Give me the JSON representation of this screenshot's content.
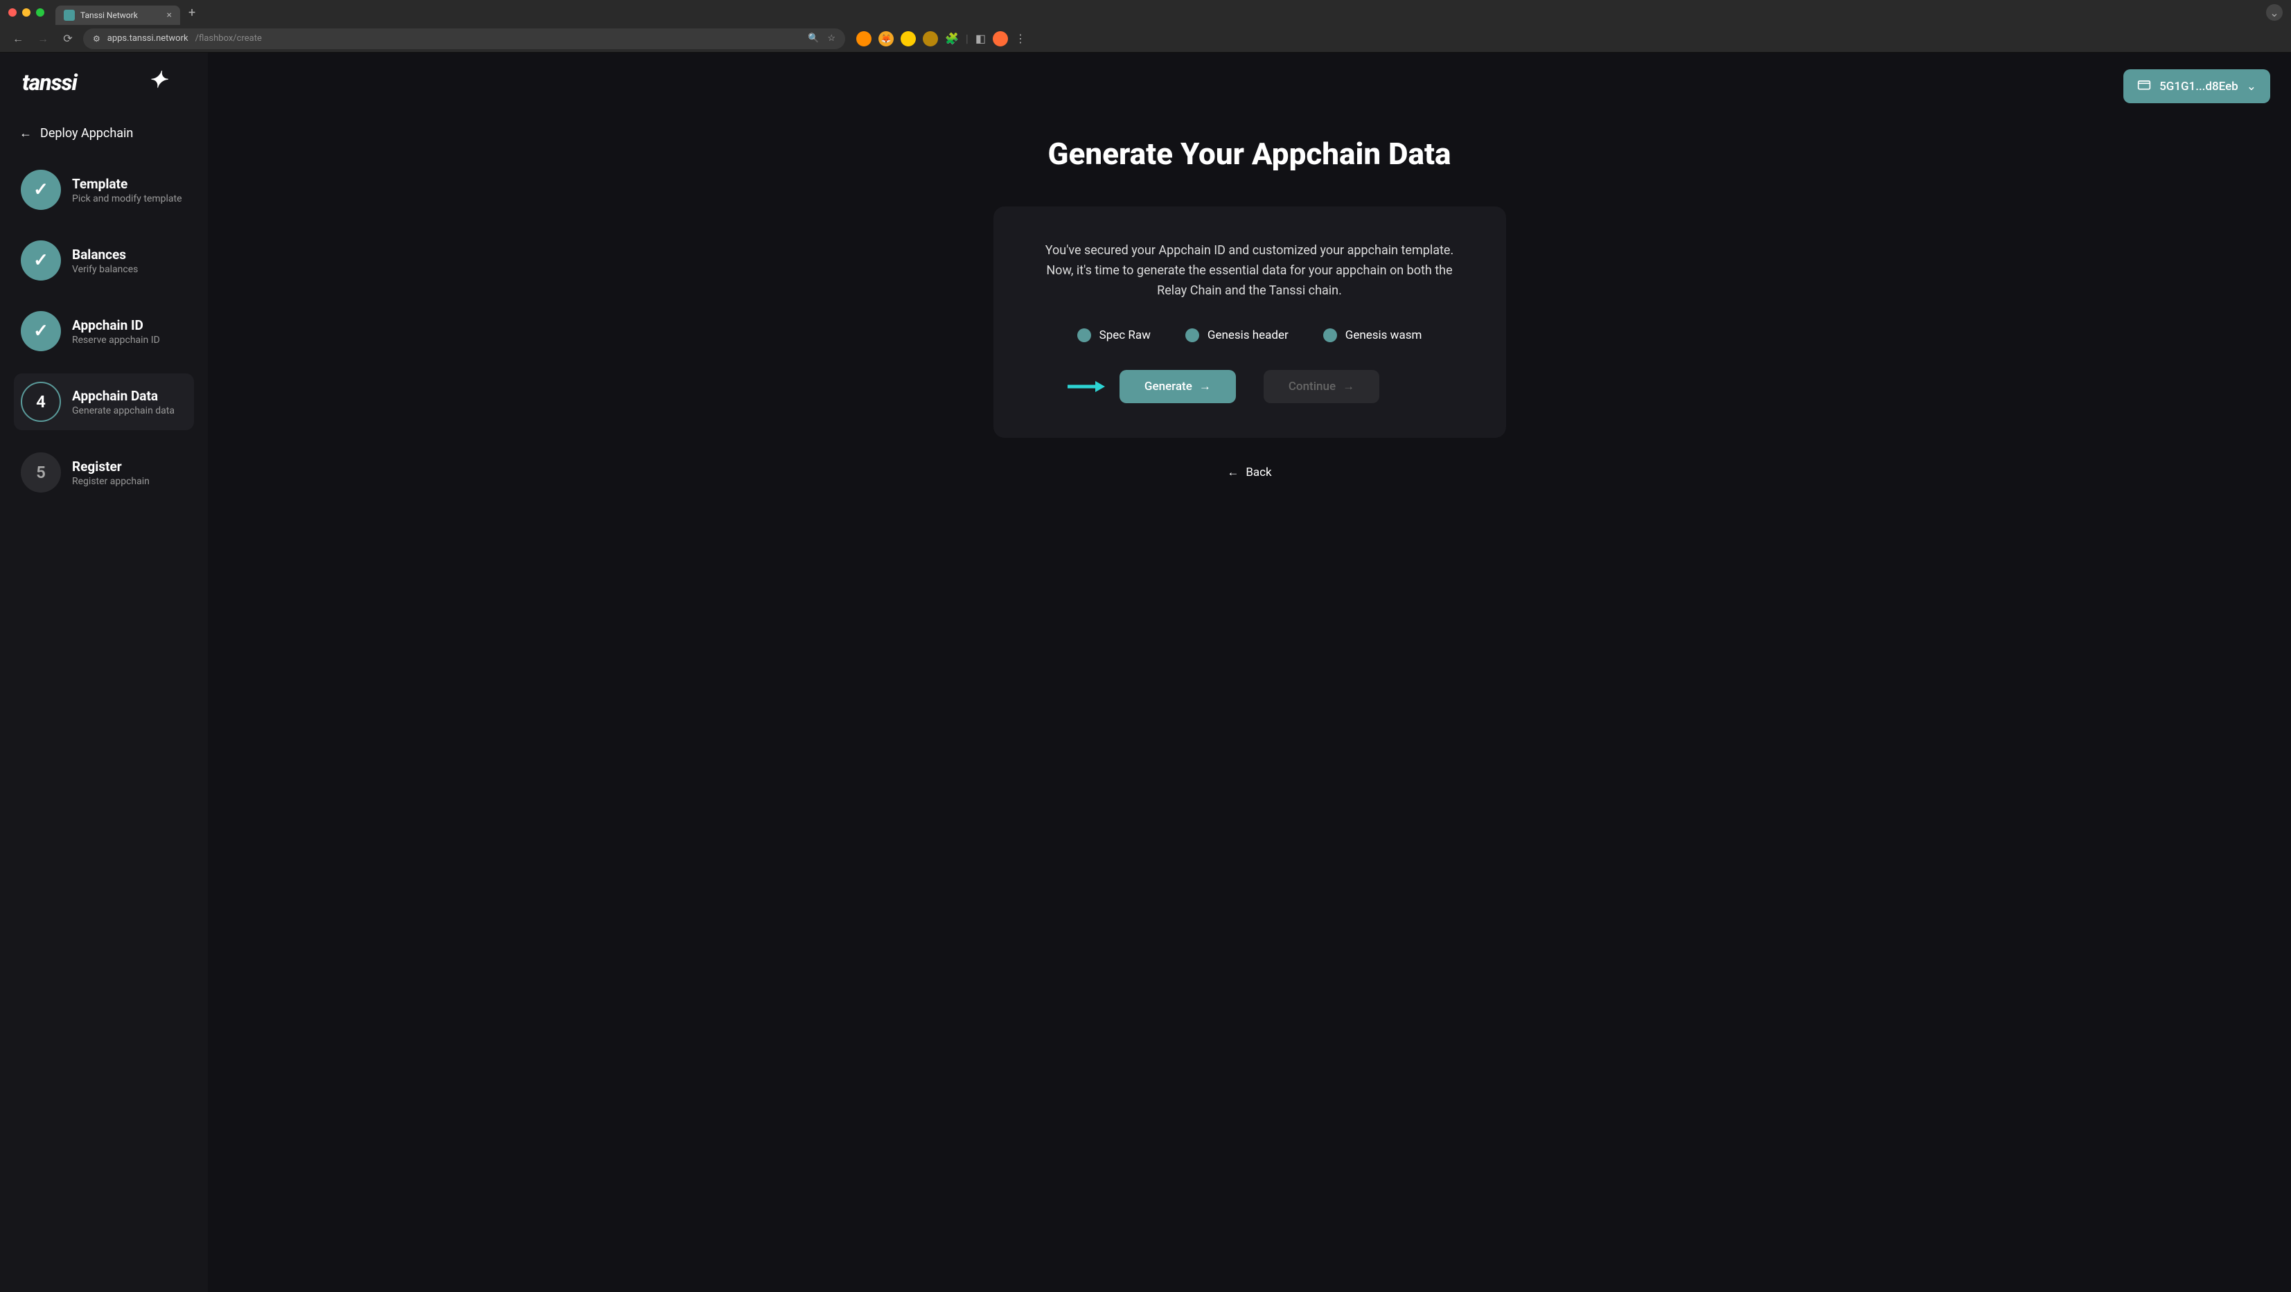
{
  "browser": {
    "tab_title": "Tanssi Network",
    "url_prefix": "apps.tanssi.network",
    "url_path": "/flashbox/create"
  },
  "logo_text": "tanssi",
  "sidebar": {
    "header": "Deploy Appchain",
    "steps": [
      {
        "title": "Template",
        "subtitle": "Pick and modify template",
        "state": "done"
      },
      {
        "title": "Balances",
        "subtitle": "Verify balances",
        "state": "done"
      },
      {
        "title": "Appchain ID",
        "subtitle": "Reserve appchain ID",
        "state": "done"
      },
      {
        "title": "Appchain Data",
        "subtitle": "Generate appchain data",
        "state": "current",
        "number": "4"
      },
      {
        "title": "Register",
        "subtitle": "Register appchain",
        "state": "pending",
        "number": "5"
      }
    ]
  },
  "wallet": {
    "address": "5G1G1...d8Eeb"
  },
  "main": {
    "title": "Generate Your Appchain Data",
    "description": "You've secured your Appchain ID and customized your appchain template. Now, it's time to generate the essential data for your appchain on both the Relay Chain and the Tanssi chain.",
    "indicators": [
      "Spec Raw",
      "Genesis header",
      "Genesis wasm"
    ],
    "generate_label": "Generate",
    "continue_label": "Continue",
    "back_label": "Back"
  },
  "colors": {
    "accent": "#5a9a9a",
    "arrow": "#2dd4d4"
  }
}
